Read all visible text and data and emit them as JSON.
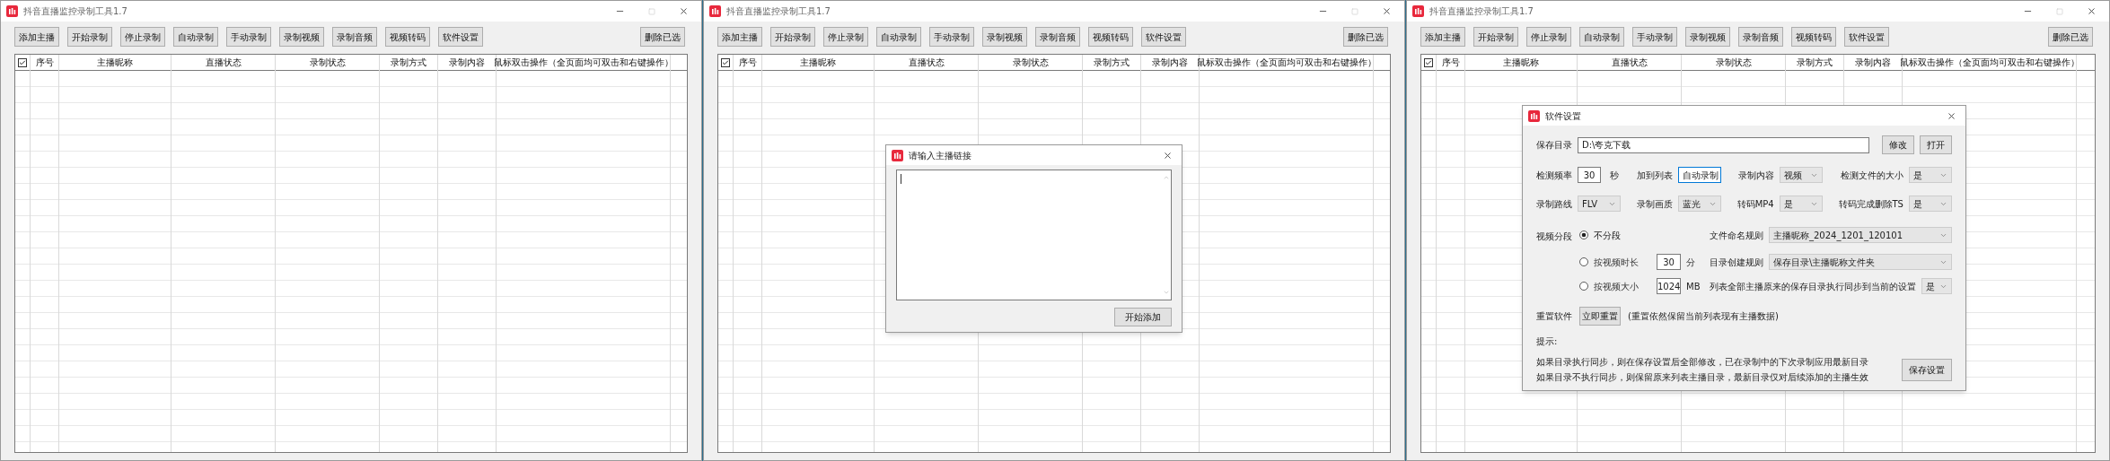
{
  "windows": [
    {
      "title": "抖音直播监控录制工具1.7",
      "toolbar": [
        "添加主播",
        "开始录制",
        "停止录制",
        "自动录制",
        "手动录制",
        "录制视频",
        "录制音频",
        "视频转码",
        "软件设置"
      ],
      "delete_button": "删除已选",
      "columns": [
        {
          "kind": "checkbox",
          "checked": true
        },
        {
          "kind": "text",
          "label": "序号"
        },
        {
          "kind": "text",
          "label": "主播昵称"
        },
        {
          "kind": "text",
          "label": "直播状态"
        },
        {
          "kind": "text",
          "label": "录制状态"
        },
        {
          "kind": "text",
          "label": "录制方式"
        },
        {
          "kind": "text",
          "label": "录制内容"
        },
        {
          "kind": "text",
          "label": "鼠标双击操作（全页面均可双击和右键操作）"
        }
      ]
    },
    {
      "title": "抖音直播监控录制工具1.7",
      "toolbar": [
        "添加主播",
        "开始录制",
        "停止录制",
        "自动录制",
        "手动录制",
        "录制视频",
        "录制音频",
        "视频转码",
        "软件设置"
      ],
      "delete_button": "删除已选",
      "columns": [
        {
          "kind": "checkbox",
          "checked": true
        },
        {
          "kind": "text",
          "label": "序号"
        },
        {
          "kind": "text",
          "label": "主播昵称"
        },
        {
          "kind": "text",
          "label": "直播状态"
        },
        {
          "kind": "text",
          "label": "录制状态"
        },
        {
          "kind": "text",
          "label": "录制方式"
        },
        {
          "kind": "text",
          "label": "录制内容"
        },
        {
          "kind": "text",
          "label": "鼠标双击操作（全页面均可双击和右键操作）"
        }
      ],
      "dialog": {
        "kind": "link_input",
        "title": "请输入主播链接",
        "button": "开始添加"
      }
    },
    {
      "title": "抖音直播监控录制工具1.7",
      "toolbar": [
        "添加主播",
        "开始录制",
        "停止录制",
        "自动录制",
        "手动录制",
        "录制视频",
        "录制音频",
        "视频转码",
        "软件设置"
      ],
      "delete_button": "删除已选",
      "columns": [
        {
          "kind": "checkbox",
          "checked": true
        },
        {
          "kind": "text",
          "label": "序号"
        },
        {
          "kind": "text",
          "label": "主播昵称"
        },
        {
          "kind": "text",
          "label": "直播状态"
        },
        {
          "kind": "text",
          "label": "录制状态"
        },
        {
          "kind": "text",
          "label": "录制方式"
        },
        {
          "kind": "text",
          "label": "录制内容"
        },
        {
          "kind": "text",
          "label": "鼠标双击操作（全页面均可双击和右键操作）"
        }
      ],
      "dialog": {
        "kind": "settings",
        "title": "软件设置",
        "save_dir": {
          "label": "保存目录",
          "value": "D:\\夸克下载",
          "buttons": [
            "修改",
            "打开"
          ]
        },
        "check_row": [
          {
            "label": "检测频率",
            "kind": "input",
            "value": "30",
            "unit": "秒"
          },
          {
            "label": "加到列表",
            "kind": "select",
            "value": "自动录制",
            "focused": true
          },
          {
            "label": "录制内容",
            "kind": "select",
            "value": "视频",
            "focused": false
          },
          {
            "label": "检测文件的大小",
            "kind": "select",
            "value": "是",
            "focused": false
          }
        ],
        "route_row": [
          {
            "label": "录制路线",
            "kind": "select",
            "value": "FLV",
            "focused": false
          },
          {
            "label": "录制画质",
            "kind": "select",
            "value": "蓝光",
            "focused": false
          },
          {
            "label": "转码MP4",
            "kind": "select",
            "value": "是",
            "focused": false
          },
          {
            "label": "转码完成删除TS",
            "kind": "select",
            "value": "是",
            "focused": false
          }
        ],
        "segment": {
          "label": "视频分段",
          "options": [
            {
              "label": "不分段",
              "selected": true
            },
            {
              "label": "按视频时长",
              "selected": false,
              "value": "30",
              "unit": "分"
            },
            {
              "label": "按视频大小",
              "selected": false,
              "value": "1024",
              "unit": "MB"
            }
          ]
        },
        "rules": [
          {
            "label": "文件命名规则",
            "value": "主播昵称_2024_1201_120101"
          },
          {
            "label": "目录创建规则",
            "value": "保存目录\\主播昵称文件夹"
          },
          {
            "label": "列表全部主播原来的保存目录执行同步到当前的设置",
            "value": "是"
          }
        ],
        "reset": {
          "label": "重置软件",
          "button": "立即重置",
          "note": "(重置依然保留当前列表现有主播数据)"
        },
        "tip_label": "提示:",
        "tips": [
          "如果目录执行同步，则在保存设置后全部修改，已在录制中的下次录制应用最新目录",
          "如果目录不执行同步，则保留原来列表主播目录，最新目录仅对后续添加的主播生效"
        ],
        "save_button": "保存设置"
      }
    }
  ]
}
